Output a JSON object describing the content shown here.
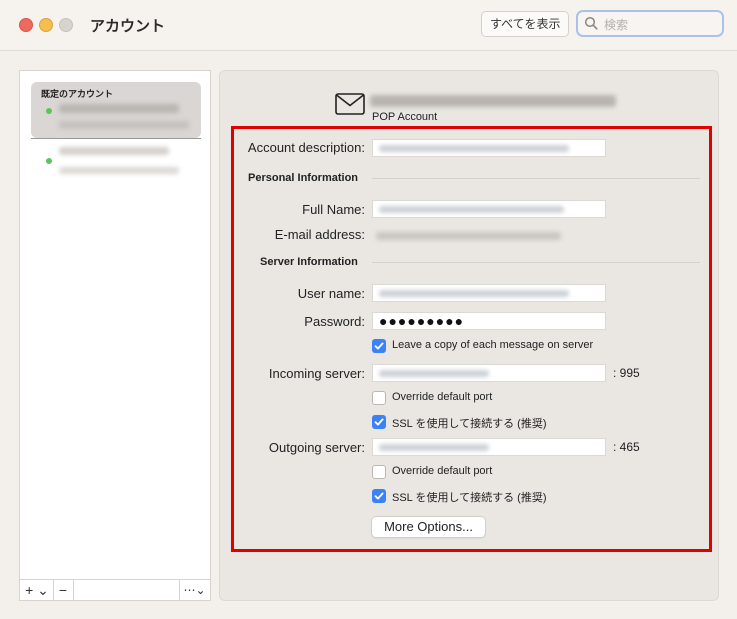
{
  "window": {
    "title": "アカウント"
  },
  "toolbar": {
    "show_all_label": "すべてを表示",
    "search_placeholder": "検索"
  },
  "sidebar": {
    "default_accounts_header": "既定のアカウント",
    "bottom_buttons": {
      "add": "+ ⌄",
      "remove": "−",
      "more": "⋯⌄"
    }
  },
  "account": {
    "type": "POP Account"
  },
  "form": {
    "account_description_label": "Account description:",
    "personal_section": "Personal Information",
    "full_name_label": "Full Name:",
    "email_label": "E-mail address:",
    "server_section": "Server Information",
    "username_label": "User name:",
    "password_label": "Password:",
    "password_value": "●●●●●●●●●",
    "leave_copy_label": "Leave a copy of each message on server",
    "incoming_label": "Incoming server:",
    "incoming_port": ": 995",
    "override_port_label": "Override default port",
    "ssl_label": "SSL を使用して接続する (推奨)",
    "outgoing_label": "Outgoing server:",
    "outgoing_port": ": 465",
    "more_options_label": "More Options..."
  },
  "checkboxes": {
    "leave_copy": true,
    "incoming_override": false,
    "incoming_ssl": true,
    "outgoing_override": false,
    "outgoing_ssl": true
  },
  "colors": {
    "accent": "#3b82f6",
    "highlight": "#e00000",
    "status_online": "#5dc45a"
  }
}
